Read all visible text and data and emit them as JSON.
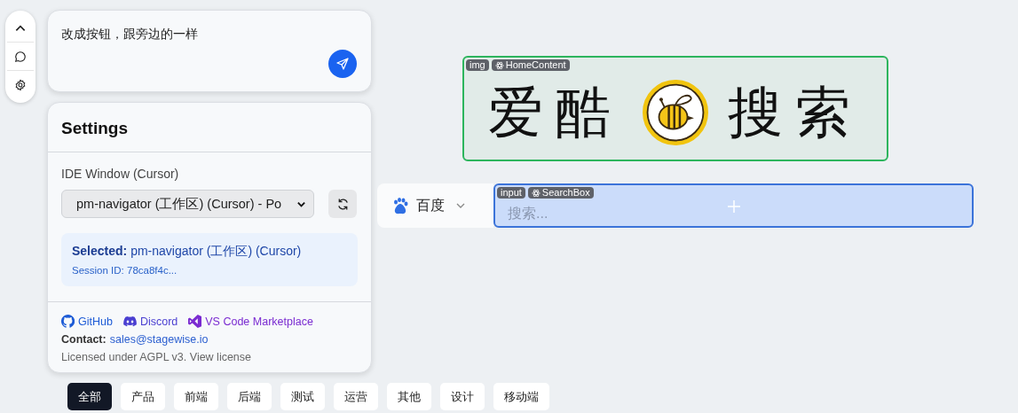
{
  "chat": {
    "value": "改成按钮，跟旁边的一样"
  },
  "settings": {
    "title": "Settings",
    "ide_label": "IDE Window (Cursor)",
    "ide_select": "pm-navigator (工作区) (Cursor) - Po",
    "selected": "**Selected:** pm-navigator (工作区) (Cursor)",
    "session": "Session ID: 78ca8f4c...",
    "links": [
      {
        "label": "GitHub",
        "kind": "github"
      },
      {
        "label": "Discord",
        "kind": "discord"
      },
      {
        "label": "VS Code Marketplace",
        "kind": "vscode"
      }
    ],
    "contact_label": "Contact:",
    "contact_email": "sales@stagewise.io",
    "license": "Licensed under AGPL v3. View license"
  },
  "logo": {
    "tags": [
      {
        "label": "img",
        "kind": "element"
      },
      {
        "label": "HomeContent",
        "kind": "component"
      }
    ],
    "title_left": "爱酷",
    "title_right": "搜索"
  },
  "search": {
    "engine": "百度",
    "placeholder": "搜索...",
    "tags": [
      {
        "label": "input",
        "kind": "element"
      },
      {
        "label": "SearchBox",
        "kind": "component"
      }
    ]
  },
  "categories": [
    {
      "label": "全部",
      "selected": true
    },
    {
      "label": "产品",
      "selected": false
    },
    {
      "label": "前端",
      "selected": false
    },
    {
      "label": "后端",
      "selected": false
    },
    {
      "label": "测试",
      "selected": false
    },
    {
      "label": "运营",
      "selected": false
    },
    {
      "label": "其他",
      "selected": false
    },
    {
      "label": "设计",
      "selected": false
    },
    {
      "label": "移动端",
      "selected": false
    }
  ]
}
